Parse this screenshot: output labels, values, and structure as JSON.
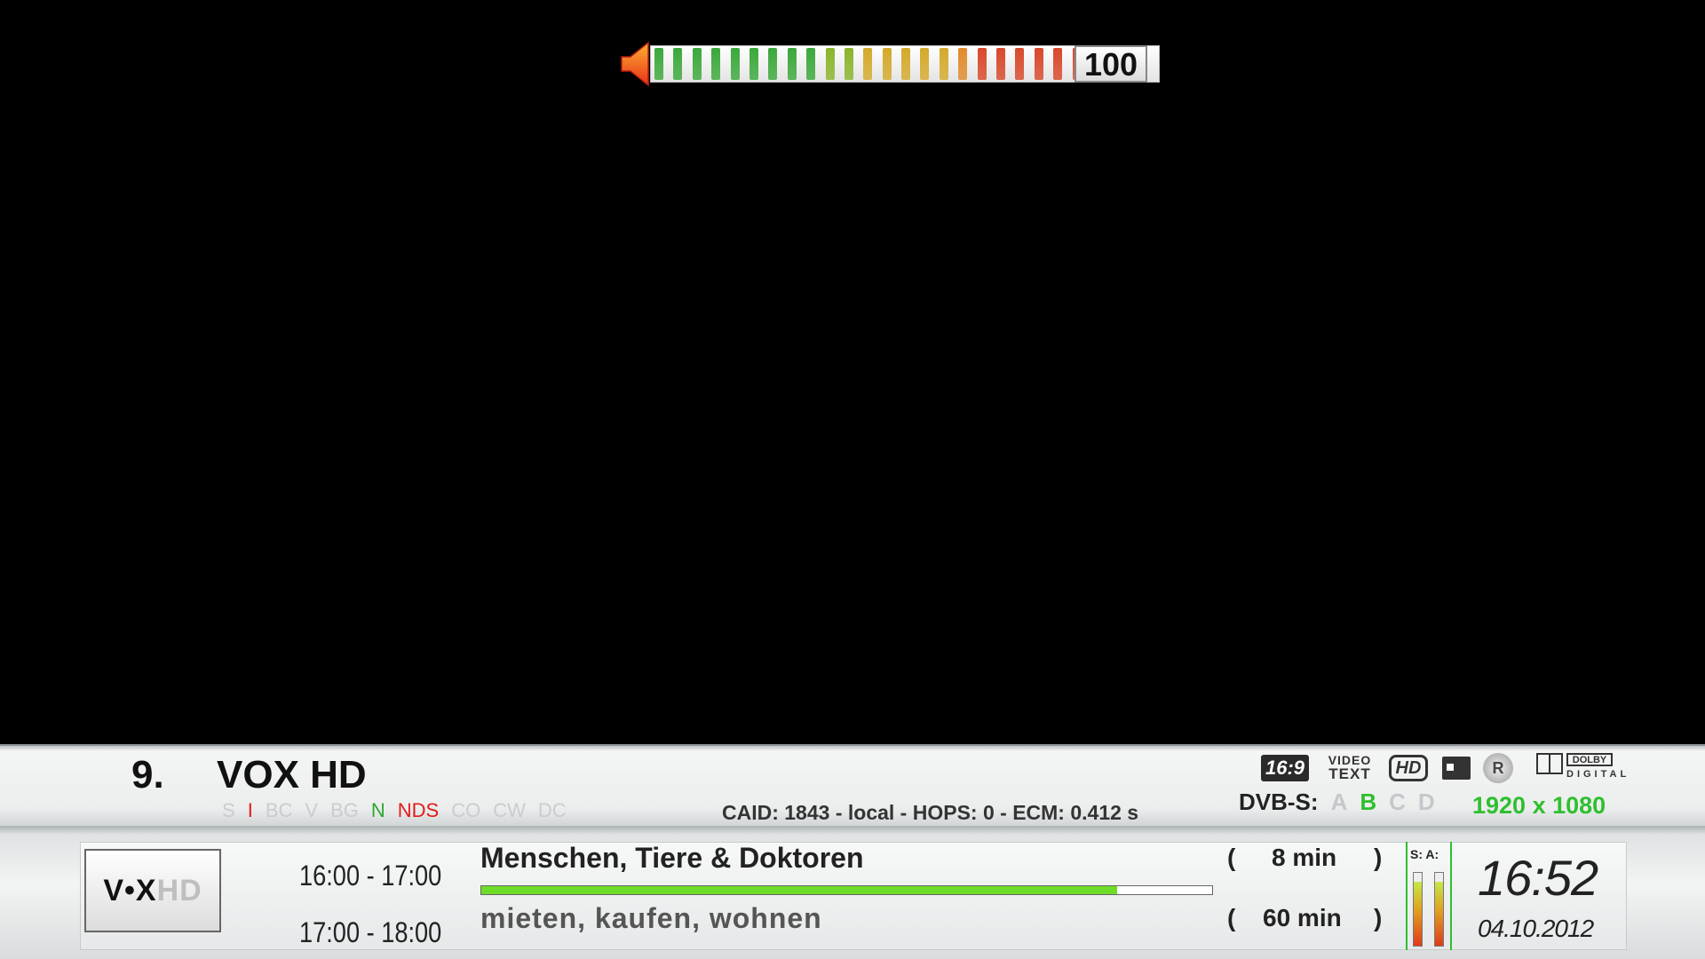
{
  "volume": {
    "value": "100",
    "level_percent": 100,
    "segment_colors": [
      "#3aa83a",
      "#3aa83a",
      "#3aa83a",
      "#3aa83a",
      "#3aa83a",
      "#3aa83a",
      "#3aa83a",
      "#3aa83a",
      "#3aa83a",
      "#8ab42a",
      "#8ab42a",
      "#d4a92a",
      "#d4a92a",
      "#d4a92a",
      "#d4a92a",
      "#d4a92a",
      "#e08a2a",
      "#d8472a",
      "#d8472a",
      "#d8472a",
      "#d8472a",
      "#d8472a",
      "#d8472a",
      "#d8472a"
    ]
  },
  "channel": {
    "number": "9.",
    "name": "VOX HD",
    "logo_main": "V•X",
    "logo_suffix": "HD"
  },
  "ca_systems": [
    {
      "label": "S",
      "state": "inactive"
    },
    {
      "label": "I",
      "state": "red"
    },
    {
      "label": "BC",
      "state": "inactive"
    },
    {
      "label": "V",
      "state": "inactive"
    },
    {
      "label": "BG",
      "state": "inactive"
    },
    {
      "label": "N",
      "state": "green"
    },
    {
      "label": "NDS",
      "state": "red"
    },
    {
      "label": "CO",
      "state": "inactive"
    },
    {
      "label": "CW",
      "state": "inactive"
    },
    {
      "label": "DC",
      "state": "inactive"
    }
  ],
  "caid_info": "CAID: 1843 - local - HOPS: 0 - ECM: 0.412 s",
  "dvb": {
    "label": "DVB-S:",
    "tuners": [
      {
        "label": "A",
        "active": false
      },
      {
        "label": "B",
        "active": true
      },
      {
        "label": "C",
        "active": false
      },
      {
        "label": "D",
        "active": false
      }
    ]
  },
  "resolution": "1920 x 1080",
  "badges": {
    "aspect": "16:9",
    "videotext_line1": "VIDEO",
    "videotext_line2": "TEXT",
    "hd": "HD",
    "rec": "R",
    "dolby_top": "DOLBY",
    "dolby_bottom": "DIGITAL"
  },
  "events": {
    "now": {
      "time": "16:00 - 17:00",
      "title": "Menschen, Tiere & Doktoren",
      "remaining": "8 min",
      "progress_percent": 87
    },
    "next": {
      "time": "17:00 - 18:00",
      "title": "mieten, kaufen, wohnen",
      "duration": "60 min"
    },
    "paren_open": "(",
    "paren_close": ")"
  },
  "meters": {
    "labels": "S: A:",
    "signal_percent": 88,
    "audio_percent": 88
  },
  "clock": {
    "time": "16:52",
    "date": "04.10.2012"
  },
  "colors": {
    "accent_green": "#2fbf2f",
    "alert_red": "#e21b1b",
    "progress_green": "#6fdc2a"
  }
}
